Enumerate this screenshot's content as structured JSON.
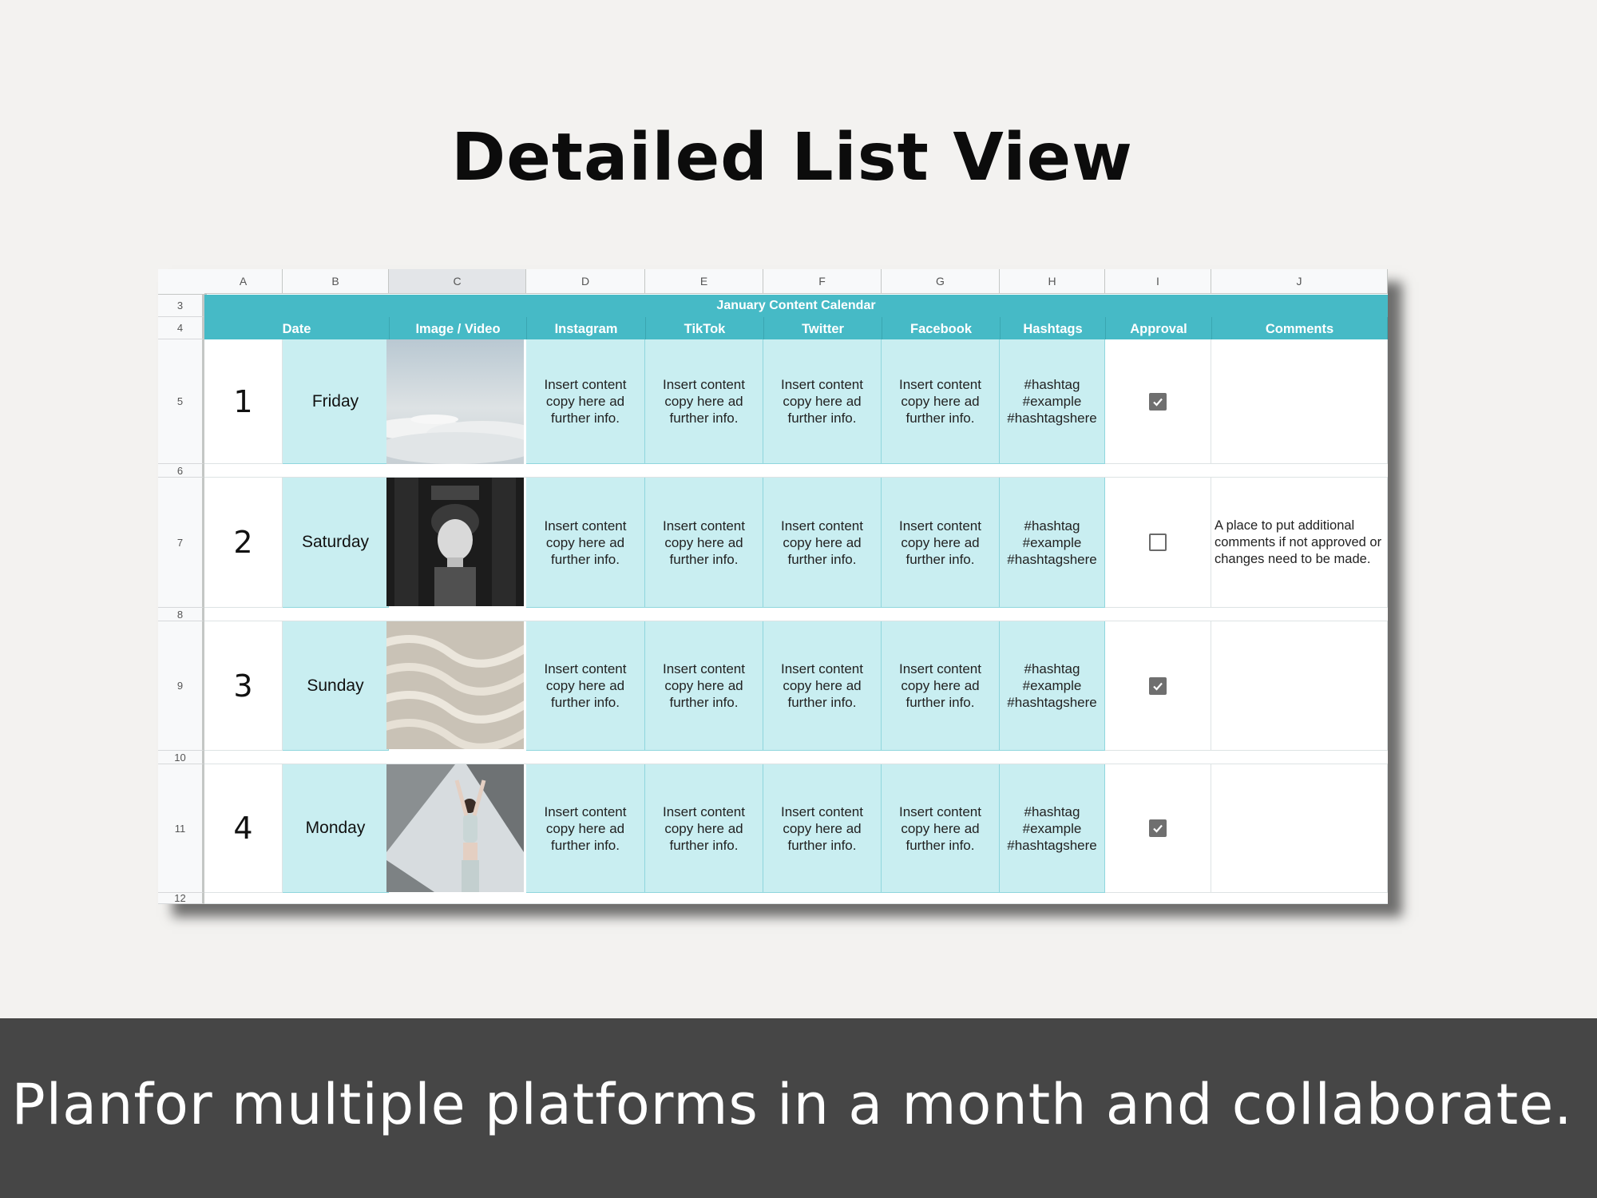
{
  "title": "Detailed List View",
  "tagline": "Planfor multiple platforms in a month and collaborate.",
  "colors": {
    "accent": "#46bac6",
    "cell_fill": "#c9eef1",
    "footer": "#464646",
    "background": "#f3f2f0"
  },
  "sheet": {
    "columns": [
      "A",
      "B",
      "C",
      "D",
      "E",
      "F",
      "G",
      "H",
      "I",
      "J"
    ],
    "selected_column": "C",
    "row_numbers": [
      "3",
      "4",
      "5",
      "6",
      "7",
      "8",
      "9",
      "10",
      "11",
      "12"
    ],
    "banner": "January Content Calendar",
    "headers": {
      "date": "Date",
      "media": "Image / Video",
      "instagram": "Instagram",
      "tiktok": "TikTok",
      "twitter": "Twitter",
      "facebook": "Facebook",
      "hashtags": "Hashtags",
      "approval": "Approval",
      "comments": "Comments"
    },
    "entries": [
      {
        "day": "1",
        "weekday": "Friday",
        "image": "clouds-photo",
        "instagram": "Insert content copy here ad further info.",
        "tiktok": "Insert content copy here ad further info.",
        "twitter": "Insert content copy here ad further info.",
        "facebook": "Insert content copy here ad further info.",
        "hashtags": [
          "#hashtag",
          "#example",
          "#hashtagshere"
        ],
        "approved": true,
        "comment": ""
      },
      {
        "day": "2",
        "weekday": "Saturday",
        "image": "statue-photo",
        "instagram": "Insert content copy here ad further info.",
        "tiktok": "Insert content copy here ad further info.",
        "twitter": "Insert content copy here ad further info.",
        "facebook": "Insert content copy here ad further info.",
        "hashtags": [
          "#hashtag",
          "#example",
          "#hashtagshere"
        ],
        "approved": false,
        "comment": "A place to put additional comments if not approved or changes need to be made."
      },
      {
        "day": "3",
        "weekday": "Sunday",
        "image": "sand-waves-photo",
        "instagram": "Insert content copy here ad further info.",
        "tiktok": "Insert content copy here ad further info.",
        "twitter": "Insert content copy here ad further info.",
        "facebook": "Insert content copy here ad further info.",
        "hashtags": [
          "#hashtag",
          "#example",
          "#hashtagshere"
        ],
        "approved": true,
        "comment": ""
      },
      {
        "day": "4",
        "weekday": "Monday",
        "image": "woman-stretching-photo",
        "instagram": "Insert content copy here ad further info.",
        "tiktok": "Insert content copy here ad further info.",
        "twitter": "Insert content copy here ad further info.",
        "facebook": "Insert content copy here ad further info.",
        "hashtags": [
          "#hashtag",
          "#example",
          "#hashtagshere"
        ],
        "approved": true,
        "comment": ""
      }
    ]
  }
}
